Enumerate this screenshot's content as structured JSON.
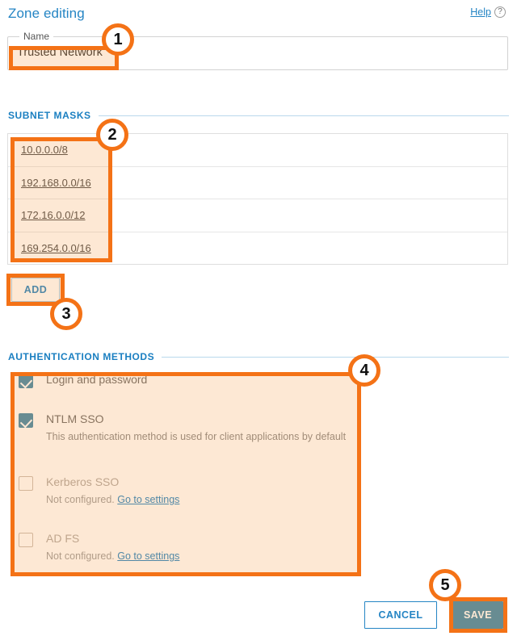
{
  "header": {
    "title": "Zone editing",
    "help_label": "Help",
    "help_icon": "question-circle-icon"
  },
  "name_field": {
    "legend": "Name",
    "value": "Trusted Network"
  },
  "subnet_section": {
    "heading": "SUBNET MASKS",
    "rows": [
      {
        "mask": "10.0.0.0/8"
      },
      {
        "mask": "192.168.0.0/16"
      },
      {
        "mask": "172.16.0.0/12"
      },
      {
        "mask": "169.254.0.0/16"
      }
    ],
    "add_label": "ADD"
  },
  "auth_section": {
    "heading": "AUTHENTICATION METHODS",
    "items": [
      {
        "label": "Login and password",
        "checked": true,
        "enabled": true,
        "desc": "",
        "link": ""
      },
      {
        "label": "NTLM SSO",
        "checked": true,
        "enabled": true,
        "desc": "This authentication method is used for client applications by default",
        "link": ""
      },
      {
        "label": "Kerberos SSO",
        "checked": false,
        "enabled": false,
        "desc": "Not configured.",
        "link": "Go to settings"
      },
      {
        "label": "AD FS",
        "checked": false,
        "enabled": false,
        "desc": "Not configured.",
        "link": "Go to settings"
      }
    ]
  },
  "footer": {
    "cancel_label": "CANCEL",
    "save_label": "SAVE"
  },
  "annotations": {
    "accent_color": "#f47216",
    "badges": [
      {
        "number": "1"
      },
      {
        "number": "2"
      },
      {
        "number": "3"
      },
      {
        "number": "4"
      },
      {
        "number": "5"
      }
    ]
  }
}
